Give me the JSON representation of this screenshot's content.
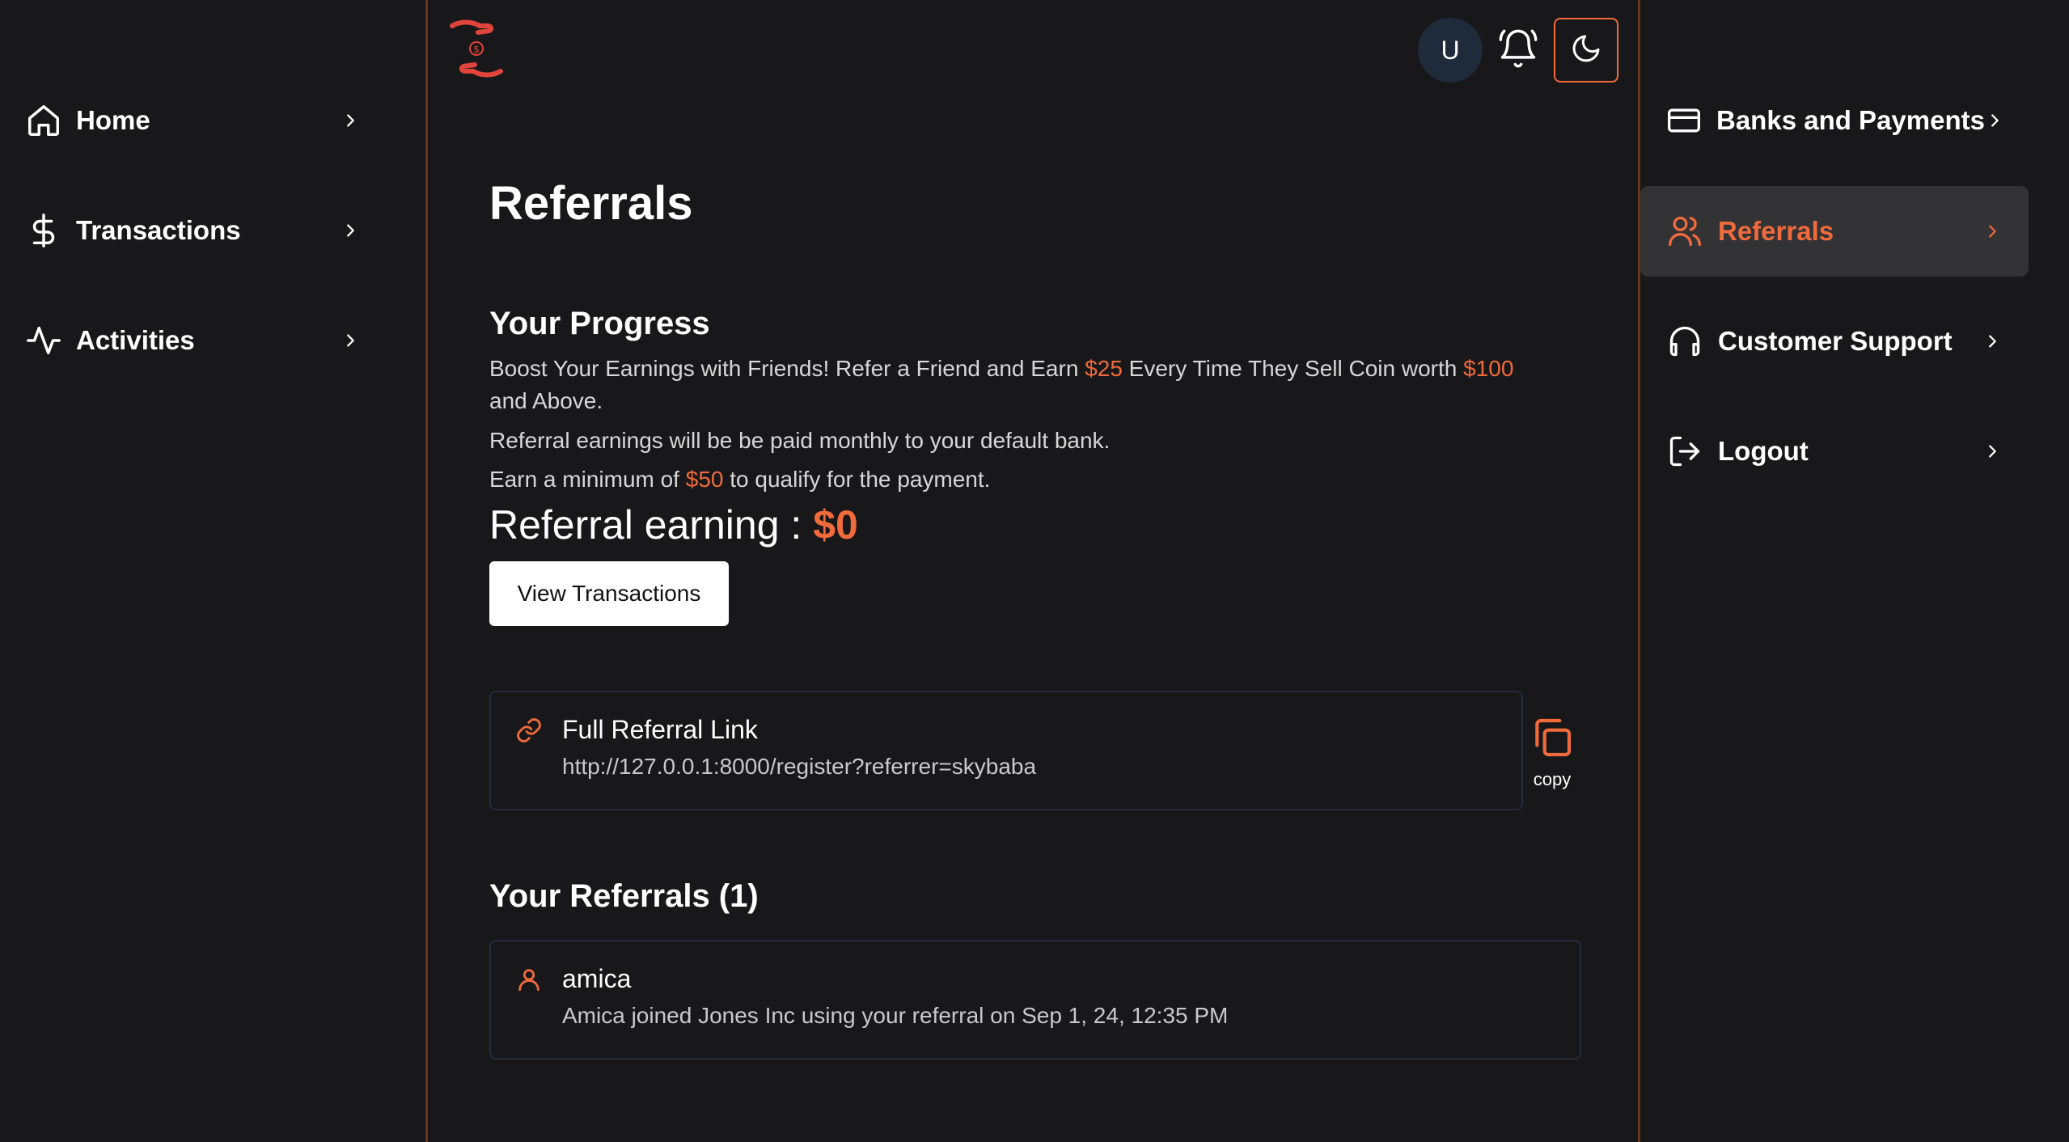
{
  "colors": {
    "accent": "#f06a3c",
    "background": "#18181a",
    "active_bg": "#333335",
    "avatar_bg": "#1f2a3a"
  },
  "left_nav": [
    {
      "label": "Home",
      "icon": "home-icon"
    },
    {
      "label": "Transactions",
      "icon": "dollar-icon"
    },
    {
      "label": "Activities",
      "icon": "activity-icon"
    }
  ],
  "header": {
    "avatar_initial": "U",
    "logo": "hands-coin-logo"
  },
  "main": {
    "title": "Referrals",
    "progress": {
      "title": "Your Progress",
      "line1_a": "Boost Your Earnings with Friends! Refer a Friend and Earn ",
      "line1_amount1": "$25",
      "line1_b": " Every Time They Sell Coin worth ",
      "line1_amount2": "$100",
      "line1_c": "and Above.",
      "line2": "Referral earnings will be be paid monthly to your default bank.",
      "line3_a": "Earn a minimum of ",
      "line3_amount": "$50",
      "line3_b": " to qualify for the payment.",
      "earning_label": "Referral earning : ",
      "earning_value": "$0",
      "view_button": "View Transactions"
    },
    "referral_link": {
      "title": "Full Referral Link",
      "url": "http://127.0.0.1:8000/register?referrer=skybaba",
      "copy_label": "copy"
    },
    "referrals": {
      "title": "Your Referrals (1)",
      "items": [
        {
          "name": "amica",
          "detail": "Amica joined Jones Inc using your referral on Sep 1, 24, 12:35 PM"
        }
      ]
    }
  },
  "right_nav": [
    {
      "label": "Banks and Payments",
      "icon": "credit-card-icon",
      "active": false
    },
    {
      "label": "Referrals",
      "icon": "users-icon",
      "active": true
    },
    {
      "label": "Customer Support",
      "icon": "headphones-icon",
      "active": false
    },
    {
      "label": "Logout",
      "icon": "logout-icon",
      "active": false
    }
  ]
}
